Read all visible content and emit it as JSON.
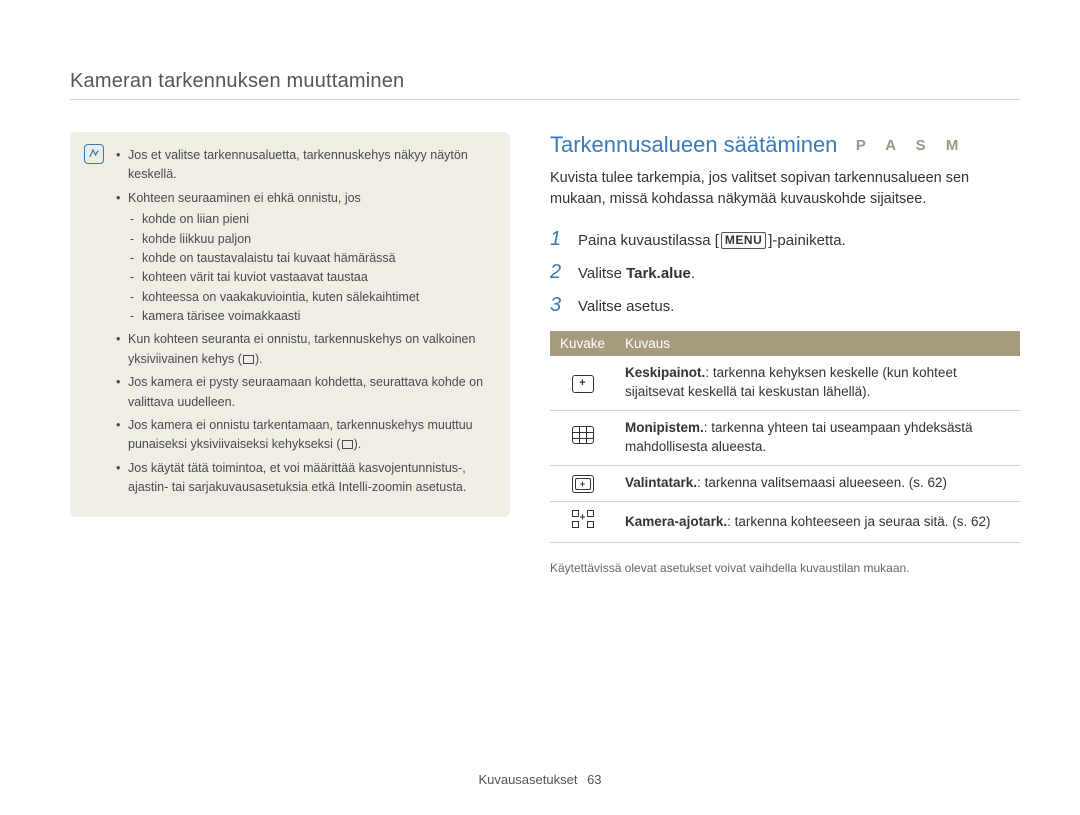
{
  "header": {
    "title": "Kameran tarkennuksen muuttaminen"
  },
  "note": {
    "items": [
      {
        "text": "Jos et valitse tarkennusaluetta, tarkennuskehys näkyy näytön keskellä."
      },
      {
        "text": "Kohteen seuraaminen ei ehkä onnistu, jos",
        "sub": [
          "kohde on liian pieni",
          "kohde liikkuu paljon",
          "kohde on taustavalaistu tai kuvaat hämärässä",
          "kohteen värit tai kuviot vastaavat taustaa",
          "kohteessa on vaakakuviointia, kuten sälekaihtimet",
          "kamera tärisee voimakkaasti"
        ]
      },
      {
        "text": "Kun kohteen seuranta ei onnistu, tarkennuskehys on valkoinen yksiviivainen kehys (",
        "appendFrame": true,
        "tail": ")."
      },
      {
        "text": "Jos kamera ei pysty seuraamaan kohdetta, seurattava kohde on valittava uudelleen."
      },
      {
        "text": "Jos kamera ei onnistu tarkentamaan, tarkennuskehys muuttuu punaiseksi yksiviivaiseksi kehykseksi (",
        "appendFrame": true,
        "tail": ")."
      },
      {
        "text": "Jos käytät tätä toimintoa, et voi määrittää kasvojentunnistus-, ajastin- tai sarjakuvausasetuksia etkä Intelli-zoomin asetusta."
      }
    ]
  },
  "section": {
    "title": "Tarkennusalueen säätäminen",
    "modes": "P A S M",
    "intro": "Kuvista tulee tarkempia, jos valitset sopivan tarkennusalueen sen mukaan, missä kohdassa näkymää kuvauskohde sijaitsee.",
    "steps": [
      {
        "num": "1",
        "pre": "Paina kuvaustilassa [",
        "menu": "MENU",
        "post": "]-painiketta."
      },
      {
        "num": "2",
        "pre": "Valitse ",
        "bold": "Tark.alue",
        "post": "."
      },
      {
        "num": "3",
        "pre": "Valitse asetus."
      }
    ],
    "table": {
      "head": {
        "col1": "Kuvake",
        "col2": "Kuvaus"
      },
      "rows": [
        {
          "icon": "center",
          "bold": "Keskipainot.",
          "text": ": tarkenna kehyksen keskelle (kun kohteet sijaitsevat keskellä tai keskustan lähellä)."
        },
        {
          "icon": "grid",
          "bold": "Monipistem.",
          "text": ": tarkenna yhteen tai useampaan yhdeksästä mahdollisesta alueesta."
        },
        {
          "icon": "select",
          "bold": "Valintatark.",
          "text": ": tarkenna valitsemaasi alueeseen. (s. 62)"
        },
        {
          "icon": "track",
          "bold": "Kamera-ajotark.",
          "text": ": tarkenna kohteeseen ja seuraa sitä. (s. 62)"
        }
      ]
    },
    "footnote": "Käytettävissä olevat asetukset voivat vaihdella kuvaustilan mukaan."
  },
  "footer": {
    "label": "Kuvausasetukset",
    "page": "63"
  }
}
